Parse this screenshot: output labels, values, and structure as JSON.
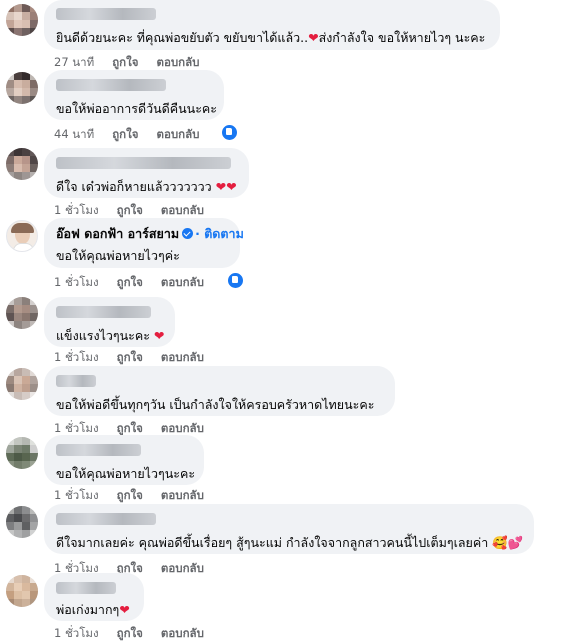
{
  "comments": [
    {
      "text": "ยินดีด้วยนะคะ ที่คุณพ่อขยับตัว ขยับขาได้แล้ว..",
      "text2": "ส่งกำลังใจ ขอให้หายไวๆ นะคะ",
      "time": "27 นาที",
      "like": "ถูกใจ",
      "reply": "ตอบกลับ"
    },
    {
      "text": "ขอให้พ่ออาการดีวันดีคืนนะคะ",
      "time": "44 นาที",
      "like": "ถูกใจ",
      "reply": "ตอบกลับ"
    },
    {
      "text": "ดีใจ เด๋วพ่อก็หายแล้ววววววว",
      "time": "1 ชั่วโมง",
      "like": "ถูกใจ",
      "reply": "ตอบกลับ"
    },
    {
      "name": "อ๊อฟ ดอกฟ้า อาร์สยาม",
      "follow": "· ติดตาม",
      "text": "ขอให้คุณพ่อหายไวๆค่ะ",
      "time": "1 ชั่วโมง",
      "like": "ถูกใจ",
      "reply": "ตอบกลับ"
    },
    {
      "text": "แข็งแรงไวๆนะคะ",
      "time": "1 ชั่วโมง",
      "like": "ถูกใจ",
      "reply": "ตอบกลับ"
    },
    {
      "text": "ขอให้พ่อดีขึ้นทุกๆวัน เป็นกำลังใจให้ครอบครัวหาดไทยนะคะ",
      "time": "1 ชั่วโมง",
      "like": "ถูกใจ",
      "reply": "ตอบกลับ"
    },
    {
      "text": "ขอให้คุณพ่อหายไวๆนะคะ",
      "time": "1 ชั่วโมง",
      "like": "ถูกใจ",
      "reply": "ตอบกลับ"
    },
    {
      "text": "ดีใจมากเลยค่ะ คุณพ่อดีขึ้นเรื่อยๆ สู้ๆนะแม่ กำลังใจจากลูกสาวคนนี้ไปเต็มๆเลยค่า",
      "time": "1 ชั่วโมง",
      "like": "ถูกใจ",
      "reply": "ตอบกลับ"
    },
    {
      "text": "พ่อเก่งมากๆ",
      "time": "1 ชั่วโมง",
      "like": "ถูกใจ",
      "reply": "ตอบกลับ"
    }
  ],
  "icons": {
    "heart": "red-heart-icon",
    "like": "thumbs-up-icon",
    "verified": "verified-badge-icon",
    "hug": "hugging-face-emoji",
    "hearts": "two-hearts-emoji"
  },
  "colors": {
    "bubble": "#f0f2f5",
    "meta": "#65676b",
    "link": "#1877f2",
    "heart": "#e41e3f"
  }
}
